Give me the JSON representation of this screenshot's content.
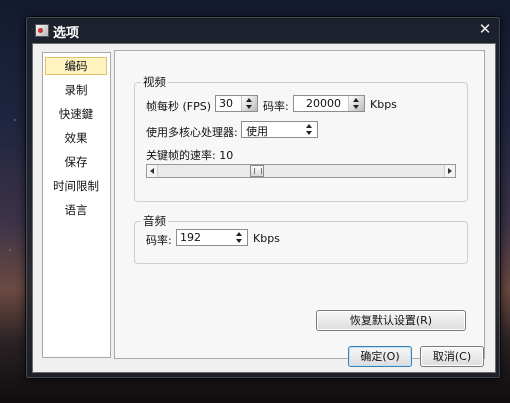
{
  "window": {
    "title": "选项",
    "close_glyph": "✕"
  },
  "sidebar": {
    "items": [
      {
        "label": "编码",
        "selected": true
      },
      {
        "label": "录制"
      },
      {
        "label": "快速鍵"
      },
      {
        "label": "效果"
      },
      {
        "label": "保存"
      },
      {
        "label": "时间限制"
      },
      {
        "label": "语言"
      }
    ]
  },
  "video": {
    "group_label": "视频",
    "fps_label": "帧每秒 (FPS) :",
    "fps_value": "30",
    "bitrate_label": "码率:",
    "bitrate_value": "20000",
    "bitrate_unit": "Kbps",
    "multicore_label": "使用多核心处理器:",
    "multicore_value": "使用",
    "keyframe_label": "关键帧的速率: 10",
    "keyframe_slider_fraction": 0.34
  },
  "audio": {
    "group_label": "音频",
    "bitrate_label": "码率:",
    "bitrate_value": "192",
    "bitrate_unit": "Kbps"
  },
  "buttons": {
    "restore_defaults": "恢复默认设置(R)",
    "ok": "确定(O)",
    "cancel": "取消(C)"
  }
}
